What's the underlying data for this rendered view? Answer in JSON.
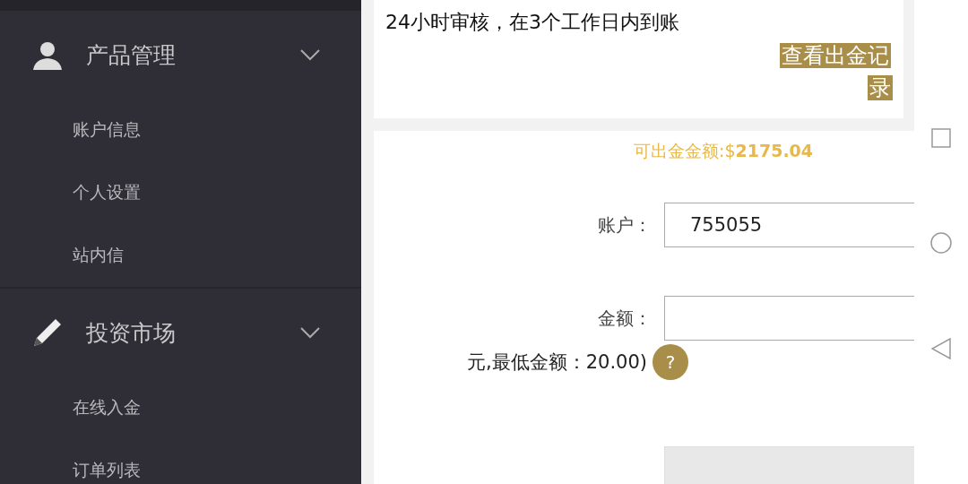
{
  "sidebar": {
    "groups": [
      {
        "title": "产品管理",
        "kind": "user",
        "expanded": true,
        "items": [
          "账户信息",
          "个人设置",
          "站内信"
        ]
      },
      {
        "title": "投资市场",
        "kind": "pencil",
        "expanded": true,
        "items": [
          "在线入金",
          "订单列表"
        ]
      }
    ]
  },
  "notice_card": {
    "text": "24小时审核，在3个工作日内到账",
    "button": "查看出金记录"
  },
  "withdraw_form": {
    "available": "可出金金额:$**2175.04**",
    "fields": [
      {
        "label": "账户：",
        "value": "755055",
        "disabled": false
      },
      {
        "label": "金额：",
        "disabled": false
      },
      {
        "disabled": true
      }
    ],
    "hint": "元,最低金额：20.00)",
    "help": "?"
  }
}
